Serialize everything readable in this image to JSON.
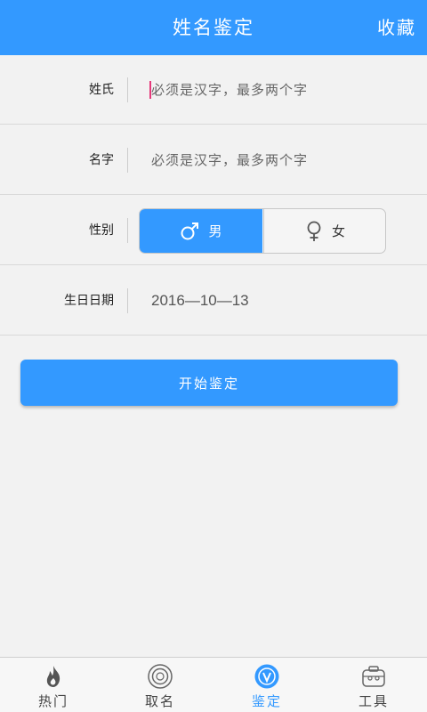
{
  "header": {
    "title": "姓名鉴定",
    "favorite_label": "收藏"
  },
  "form": {
    "surname": {
      "label": "姓氏",
      "placeholder": "必须是汉字，最多两个字"
    },
    "given_name": {
      "label": "名字",
      "placeholder": "必须是汉字，最多两个字"
    },
    "gender": {
      "label": "性别",
      "male_label": "男",
      "female_label": "女",
      "selected": "男"
    },
    "birthday": {
      "label": "生日日期",
      "value": "2016—10—13"
    }
  },
  "start_button": {
    "label": "开始鉴定"
  },
  "tabbar": {
    "items": [
      {
        "label": "热门",
        "icon": "flame-icon"
      },
      {
        "label": "取名",
        "icon": "name-badge-icon"
      },
      {
        "label": "鉴定",
        "icon": "verify-v-icon",
        "active": true
      },
      {
        "label": "工具",
        "icon": "toolbox-icon"
      }
    ]
  },
  "colors": {
    "primary": "#3399ff",
    "caret": "#e5397a",
    "background": "#f2f2f2"
  }
}
